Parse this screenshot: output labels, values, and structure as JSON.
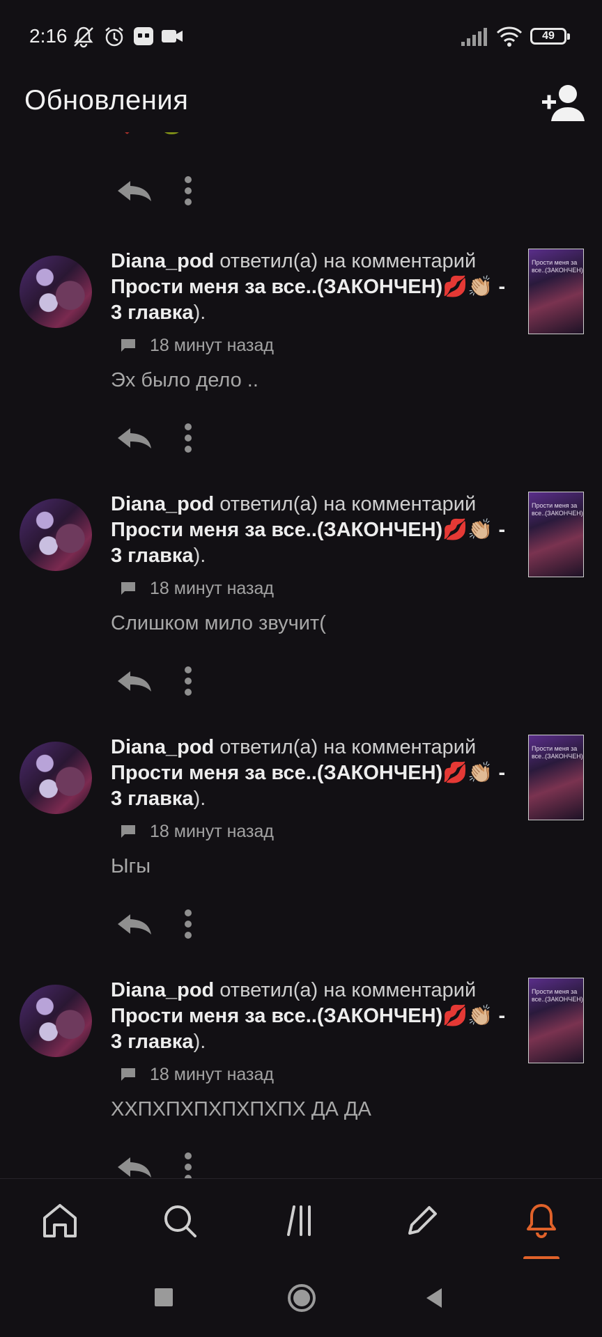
{
  "status_bar": {
    "time": "2:16",
    "battery": "49",
    "icons": [
      "mute-bell-icon",
      "alarm-icon",
      "app-notification-icon",
      "video-camera-icon",
      "signal-icon",
      "wifi-icon",
      "battery-icon"
    ]
  },
  "header": {
    "title": "Обновления",
    "add_friend_icon": "add-person-icon"
  },
  "feed": {
    "top_remnant_emoji": "❤️😊🐸",
    "items": [
      {
        "user": "Diana_pod",
        "action": " ответил(а) на комментарий ",
        "story": "Прости меня за все..(ЗАКОНЧЕН)",
        "emoji": "💋👏🏼",
        "chapter": " - 3 главка",
        "tail": ").",
        "time": "18 минут назад",
        "comment": "Эх было дело ..",
        "thumb_text": "Прости меня за все..(ЗАКОНЧЕН)"
      },
      {
        "user": "Diana_pod",
        "action": " ответил(а) на комментарий ",
        "story": "Прости меня за все..(ЗАКОНЧЕН)",
        "emoji": "💋👏🏼",
        "chapter": " - 3 главка",
        "tail": ").",
        "time": "18 минут назад",
        "comment": "Слишком мило звучит(",
        "thumb_text": "Прости меня за все..(ЗАКОНЧЕН)"
      },
      {
        "user": "Diana_pod",
        "action": " ответил(а) на комментарий ",
        "story": "Прости меня за все..(ЗАКОНЧЕН)",
        "emoji": "💋👏🏼",
        "chapter": " - 3 главка",
        "tail": ").",
        "time": "18 минут назад",
        "comment": "Ыгы",
        "thumb_text": "Прости меня за все..(ЗАКОНЧЕН)"
      },
      {
        "user": "Diana_pod",
        "action": " ответил(а) на комментарий ",
        "story": "Прости меня за все..(ЗАКОНЧЕН)",
        "emoji": "💋👏🏼",
        "chapter": " - 3 главка",
        "tail": ").",
        "time": "18 минут назад",
        "comment": "ХХПХПХПХПХПХПХ ДА ДА",
        "thumb_text": "Прости меня за все..(ЗАКОНЧЕН)"
      }
    ]
  },
  "bottom_nav": {
    "items": [
      "home-icon",
      "search-icon",
      "library-icon",
      "write-icon",
      "notifications-bell-icon"
    ],
    "active": "notifications-bell-icon",
    "active_color": "#e0622a"
  },
  "system_nav": {
    "items": [
      "recent-apps-icon",
      "home-circle-icon",
      "back-icon"
    ]
  }
}
